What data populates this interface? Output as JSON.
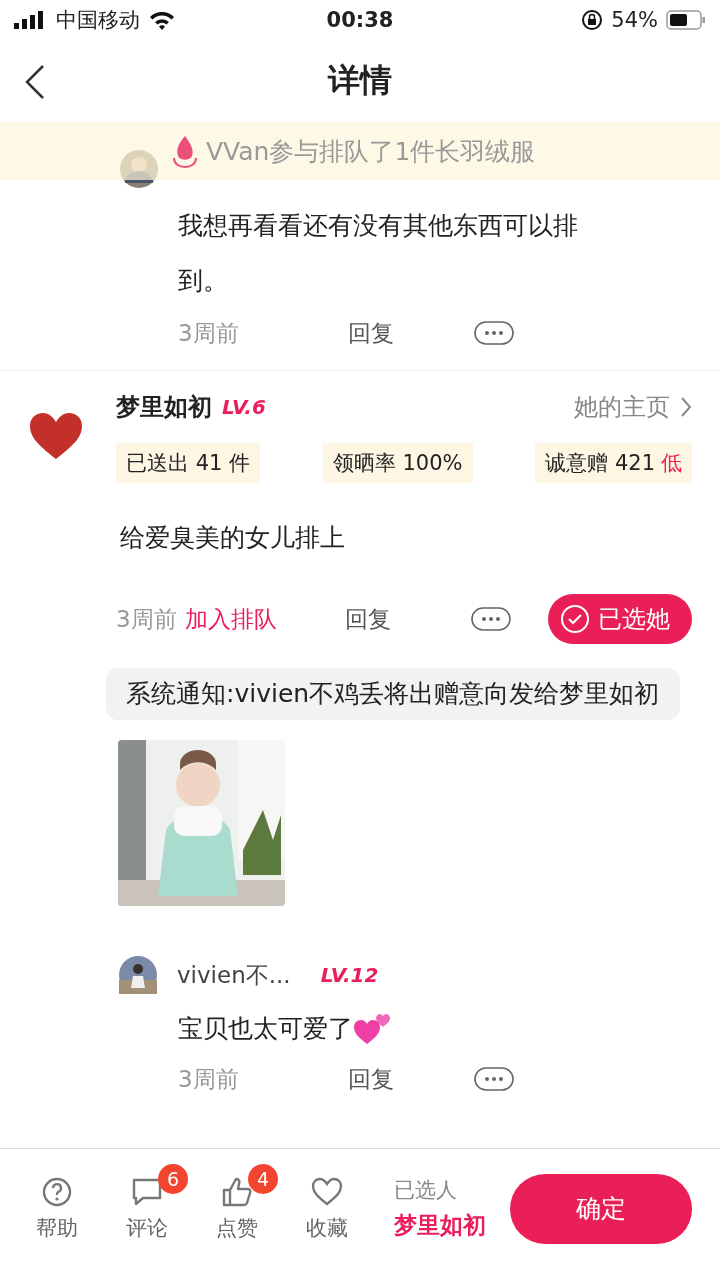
{
  "status_bar": {
    "carrier": "中国移动",
    "time": "00:38",
    "battery": "54%"
  },
  "nav": {
    "title": "详情"
  },
  "banner": {
    "text": "VVan参与排队了1件长羽绒服"
  },
  "top_reply": {
    "text": "我想再看看还有没有其他东西可以排到。",
    "time": "3周前",
    "reply": "回复"
  },
  "main_comment": {
    "name": "梦里如初",
    "level": "LV.6",
    "homepage": "她的主页",
    "stats": [
      {
        "text": "已送出 41 件"
      },
      {
        "text": "领晒率 100%"
      },
      {
        "text": "诚意赠 421",
        "flag": "低"
      }
    ],
    "text": "给爱臭美的女儿排上",
    "time": "3周前",
    "join": "加入排队",
    "reply": "回复",
    "choose": {
      "label": "已选她",
      "selected": true
    },
    "notice": "系统通知:vivien不鸡丢将出赠意向发给梦里如初"
  },
  "sub_reply": {
    "name": "vivien不...",
    "level": "LV.12",
    "text": "宝贝也太可爱了",
    "time": "3周前",
    "reply": "回复"
  },
  "bottom_bar": {
    "actions": [
      {
        "kind": "help",
        "label": "帮助"
      },
      {
        "kind": "comment",
        "label": "评论",
        "badge": "6"
      },
      {
        "kind": "like",
        "label": "点赞",
        "badge": "4"
      },
      {
        "kind": "favorite",
        "label": "收藏"
      }
    ],
    "chosen_label": "已选人",
    "chosen_name": "梦里如初",
    "confirm": "确定"
  }
}
